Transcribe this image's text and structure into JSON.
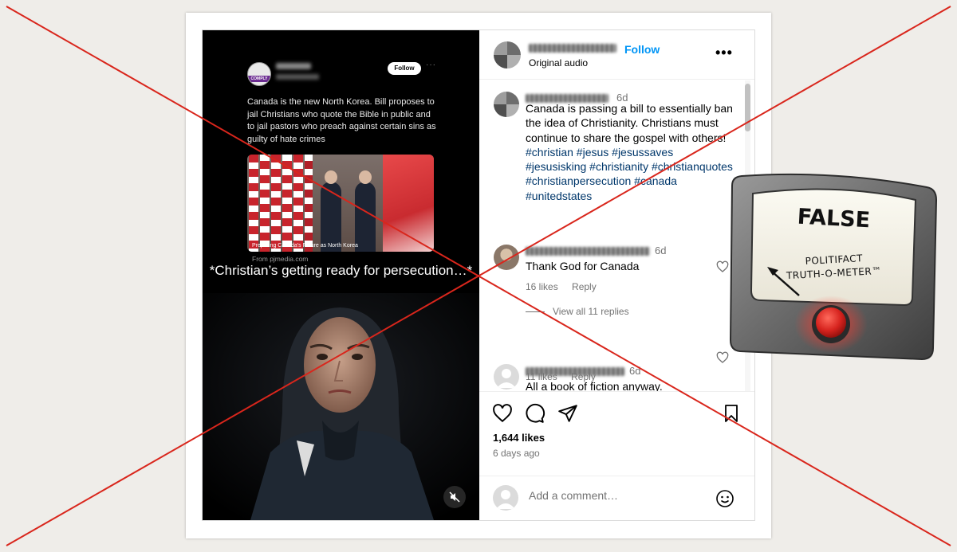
{
  "media": {
    "tweet": {
      "avatar_badge": "COMPLY",
      "follow_label": "Follow",
      "more_label": "···",
      "text": "Canada is the new North Korea. Bill proposes to jail Christians who quote the Bible in public and to jail pastors who preach against certain sins as guilty of hate crimes",
      "image_caption": "Preparing Canada's Future as North Korea",
      "from_label": "From pjmedia.com"
    },
    "overlay_text": "*Christian’s getting ready for persecution…*",
    "mute_icon": "speaker-muted-icon"
  },
  "post": {
    "header": {
      "follow_label": "Follow",
      "audio_label": "Original audio",
      "more_label": "•••"
    },
    "caption": {
      "time": "6d",
      "text": "Canada is passing a bill to essentially ban the idea of Christianity. Christians must continue to share the gospel with others!",
      "hashtags": "#christian #jesus #jesussaves #jesusisking #christianity #christianquotes #christianpersecution #canada #unitedstates"
    },
    "comments": [
      {
        "time": "6d",
        "text": "Thank God for Canada",
        "likes": "16 likes",
        "reply": "Reply"
      },
      {
        "time": "6d",
        "text": "All a book of fiction anyway.",
        "likes": "11 likes",
        "reply": "Reply"
      }
    ],
    "view_replies": "View all 11 replies",
    "likes_count": "1,644 likes",
    "posted_ago": "6 days ago",
    "add_comment_placeholder": "Add a comment…"
  },
  "meter": {
    "rating": "FALSE",
    "brand_line1": "POLITIFACT",
    "brand_line2": "TRUTH-O-METER™"
  },
  "colors": {
    "follow_blue": "#0095f6",
    "hashtag_blue": "#00376b",
    "cross_red": "#d9261c",
    "meter_button_red": "#d6231e"
  }
}
